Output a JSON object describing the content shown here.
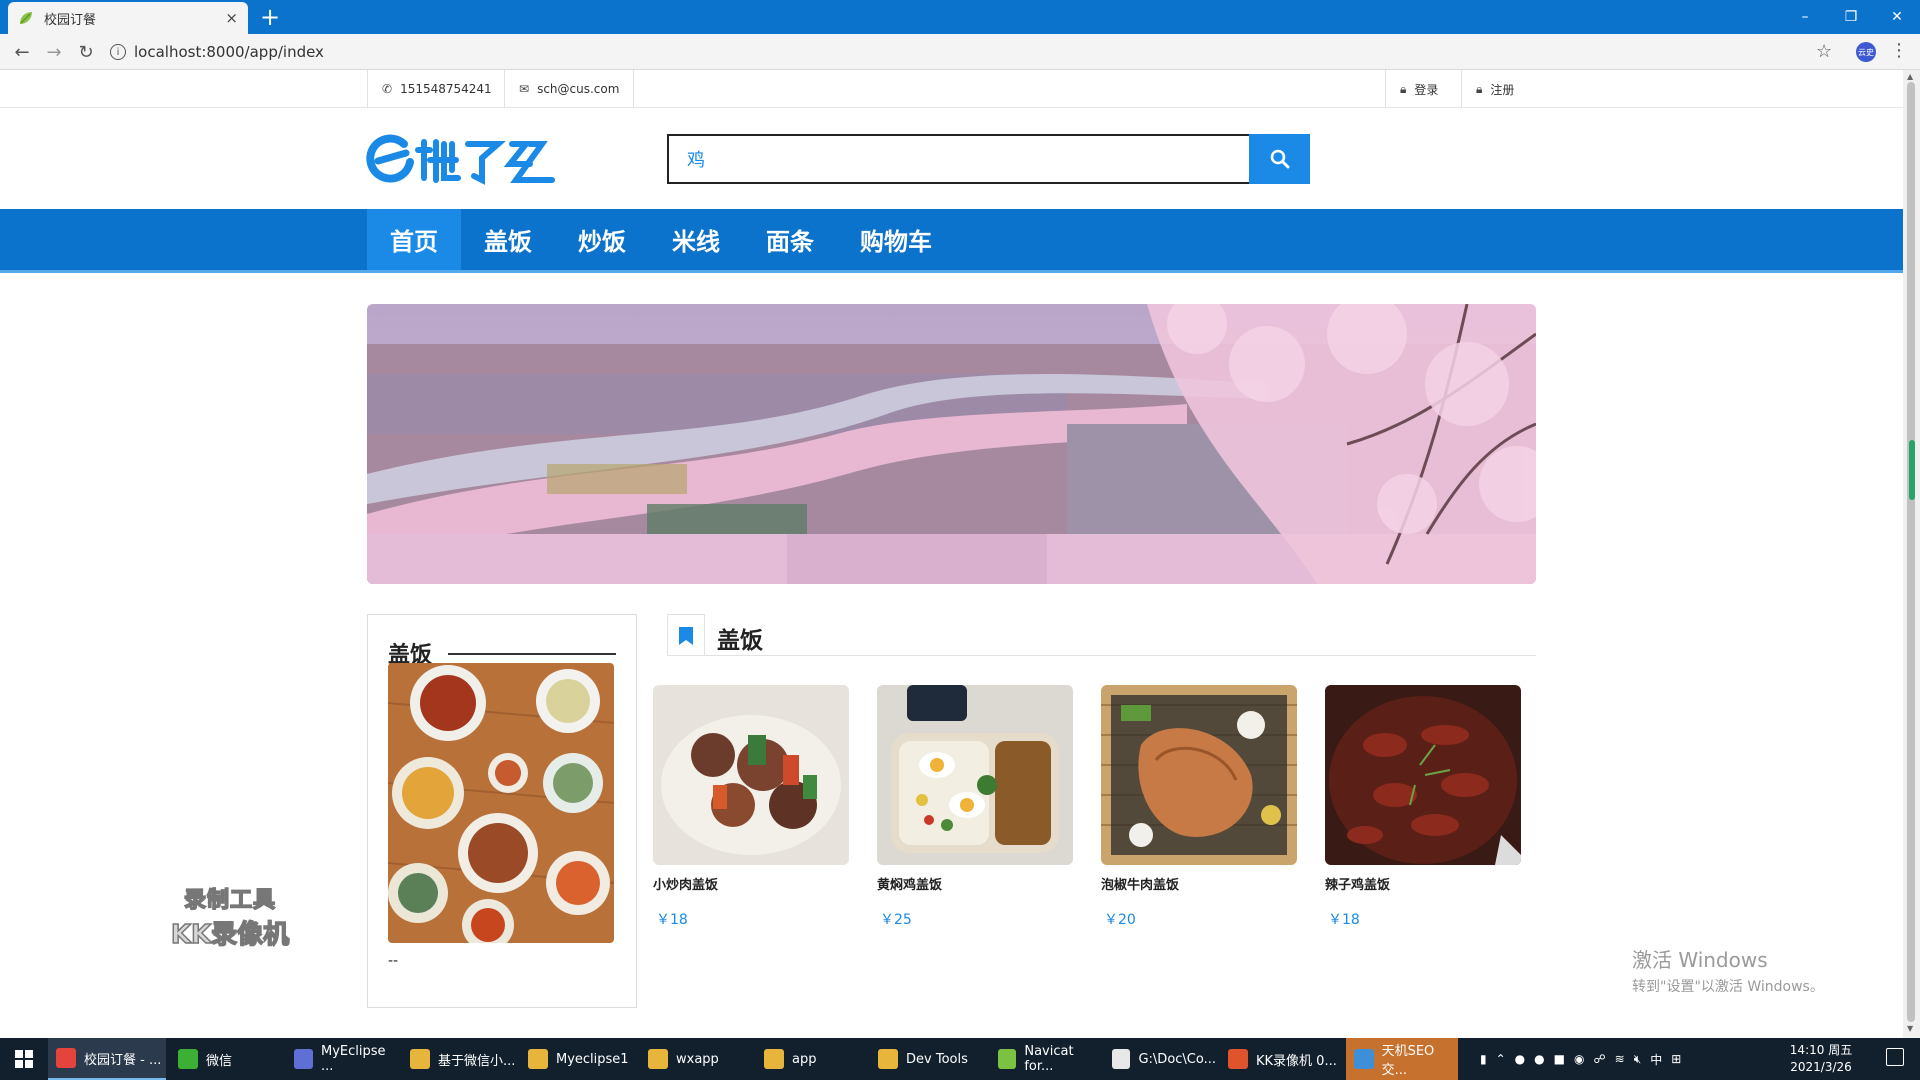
{
  "browser": {
    "tab_title": "校园订餐",
    "tab_close": "×",
    "new_tab": "+",
    "url": "localhost:8000/app/index",
    "info_icon": "i",
    "profile_text": "云史",
    "window_controls": [
      "–",
      "❐",
      "✕"
    ]
  },
  "contact": {
    "phone": "151548754241",
    "email": "sch@cus.com",
    "login": "登录",
    "register": "注册"
  },
  "search": {
    "value": "鸡",
    "placeholder": ""
  },
  "nav": {
    "items": [
      "首页",
      "盖饭",
      "炒饭",
      "米线",
      "面条",
      "购物车"
    ]
  },
  "sidecard": {
    "title": "盖饭",
    "caption": "--"
  },
  "section": {
    "title": "盖饭"
  },
  "products": [
    {
      "name": "小炒肉盖饭",
      "price": "￥18"
    },
    {
      "name": "黄焖鸡盖饭",
      "price": "￥25"
    },
    {
      "name": "泡椒牛肉盖饭",
      "price": "￥20"
    },
    {
      "name": "辣子鸡盖饭",
      "price": "￥18"
    }
  ],
  "watermark": {
    "line1": "录制工具",
    "line2": "KK录像机"
  },
  "activation": {
    "line1": "激活 Windows",
    "line2": "转到\"设置\"以激活 Windows。"
  },
  "taskbar": {
    "items": [
      "校园订餐 - ...",
      "微信",
      "MyEclipse ...",
      "基于微信小...",
      "Myeclipse1",
      "wxapp",
      "app",
      "Dev Tools",
      "Navicat for...",
      "G:\\Doc\\Co...",
      "KK录像机 0...",
      "天机SEO交..."
    ],
    "ime": "中",
    "time": "14:10 周五",
    "date": "2021/3/26"
  },
  "colors": {
    "brand_blue": "#0b73cc",
    "accent_blue": "#1a8ae6",
    "price_blue": "#1a8ae6"
  }
}
